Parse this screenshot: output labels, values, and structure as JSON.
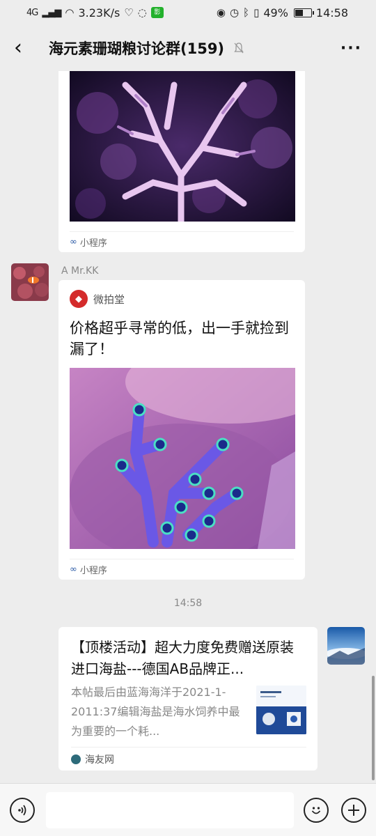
{
  "status_bar": {
    "signal": "4G",
    "speed": "3.23K/s",
    "app_badge": "影",
    "battery": "49%",
    "time": "14:58"
  },
  "header": {
    "title": "海元素珊瑚粮讨论群(159)"
  },
  "messages": [
    {
      "kind": "mini_program_partial",
      "footer_label": "小程序"
    },
    {
      "kind": "mini_program",
      "sender": "A Mr.KK",
      "brand": "微拍堂",
      "title": "价格超乎寻常的低，出一手就捡到漏了！",
      "footer_label": "小程序"
    },
    {
      "kind": "timestamp",
      "text": "14:58"
    },
    {
      "kind": "link_card",
      "title": "【顶楼活动】超大力度免费赠送原装进口海盐---德国AB品牌正...",
      "description": "本帖最后由蓝海海洋于2021-1-2011:37编辑海盐是海水饲养中最为重要的一个耗...",
      "source": "海友网"
    }
  ],
  "input_bar": {
    "placeholder": ""
  },
  "colors": {
    "background": "#ededed",
    "card": "#ffffff",
    "brand_red": "#d42b2b"
  }
}
